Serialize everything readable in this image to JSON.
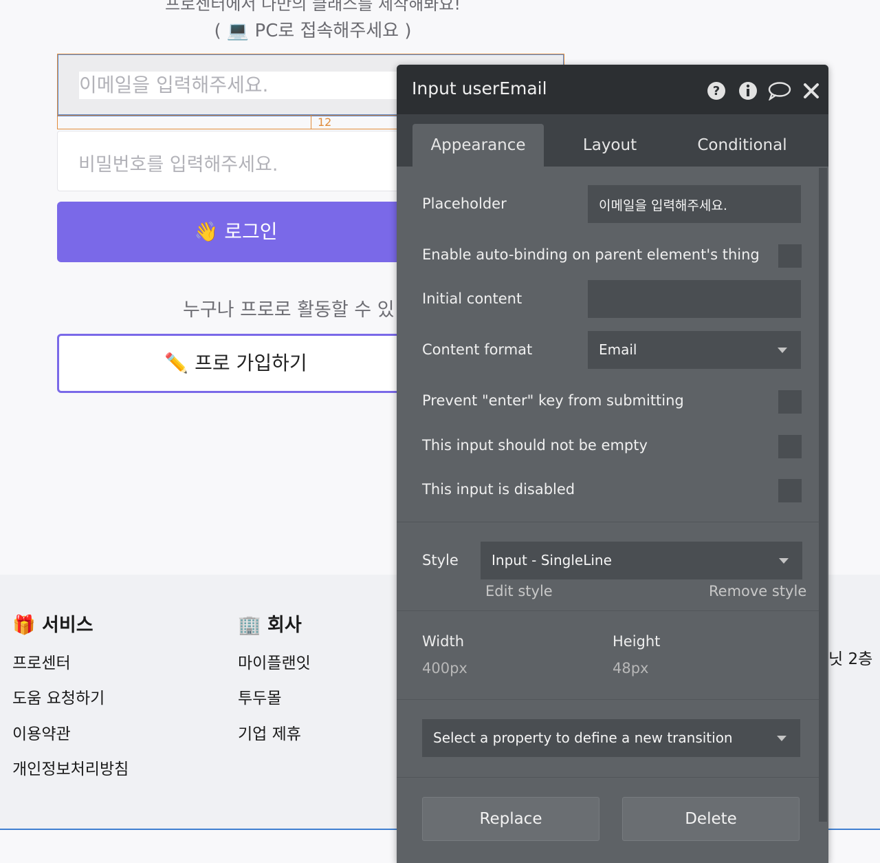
{
  "login": {
    "top_line1": "프로센터에서 나만의 클래스를 제작해봐요!",
    "top_line2": "( 💻 PC로 접속해주세요 )",
    "email_placeholder": "이메일을 입력해주세요.",
    "gap_value": "12",
    "password_placeholder": "비밀번호를 입력해주세요.",
    "login_button": "👋 로그인",
    "tagline": "누구나 프로로 활동할 수 있",
    "pro_signup_button": "✏️ 프로 가입하기"
  },
  "footer": {
    "service_title": "🎁 서비스",
    "service_links": [
      "프로센터",
      "도움 요청하기",
      "이용약관",
      "개인정보처리방침"
    ],
    "company_title": "🏢 회사",
    "company_links": [
      "마이플랜잇",
      "투두몰",
      "기업 제휴"
    ],
    "right_text": "닛 2층"
  },
  "panel": {
    "title": "Input userEmail",
    "header_icons": [
      "help-icon",
      "info-icon",
      "comment-icon",
      "close-icon"
    ],
    "tabs": [
      {
        "label": "Appearance",
        "active": true
      },
      {
        "label": "Layout",
        "active": false
      },
      {
        "label": "Conditional",
        "active": false
      }
    ],
    "placeholder_label": "Placeholder",
    "placeholder_value": "이메일을 입력해주세요.",
    "auto_binding_label": "Enable auto-binding on parent element's thing",
    "initial_content_label": "Initial content",
    "initial_content_value": "",
    "content_format_label": "Content format",
    "content_format_value": "Email",
    "prevent_enter_label": "Prevent \"enter\" key from submitting",
    "not_empty_label": "This input should not be empty",
    "disabled_label": "This input is disabled",
    "style_label": "Style",
    "style_value": "Input - SingleLine",
    "edit_style": "Edit style",
    "remove_style": "Remove style",
    "width_label": "Width",
    "width_value": "400px",
    "height_label": "Height",
    "height_value": "48px",
    "transition_placeholder": "Select a property to define a new transition",
    "replace_button": "Replace",
    "delete_button": "Delete"
  },
  "colors": {
    "accent_purple": "#7a69e8",
    "panel_dark": "#2c2f32",
    "panel_body": "#5e6266",
    "selection_orange": "#e08b3a",
    "selection_blue": "#4a79c4"
  }
}
